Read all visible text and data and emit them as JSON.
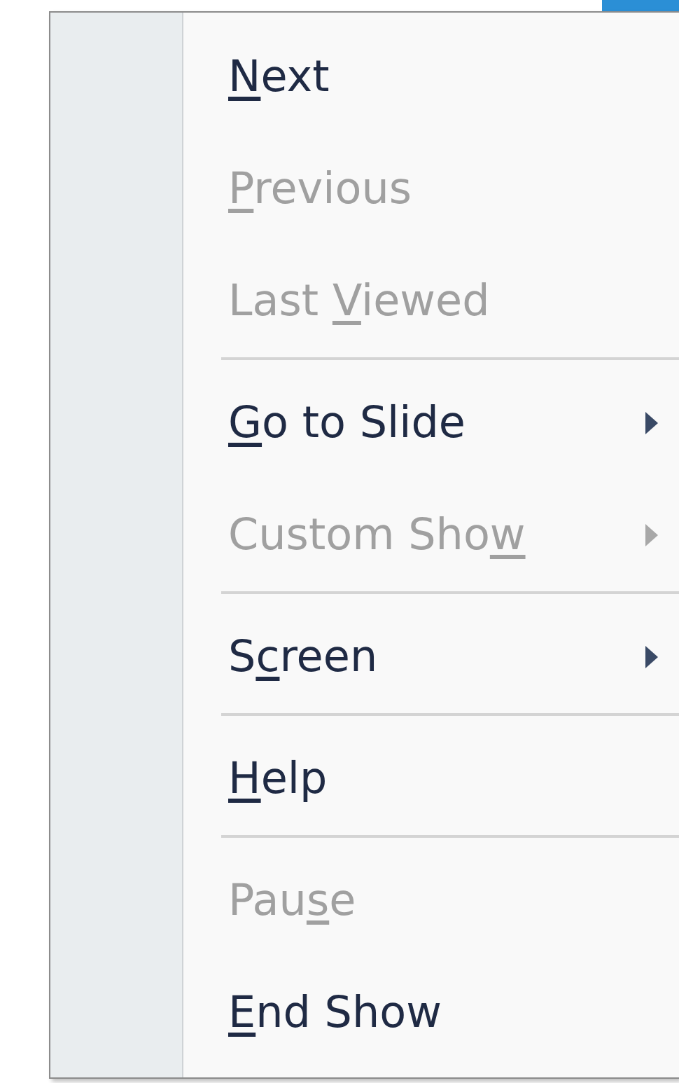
{
  "menu": {
    "items": [
      {
        "kind": "item",
        "key": "N",
        "after": "ext",
        "disabled": false,
        "submenu": false
      },
      {
        "kind": "item",
        "key": "P",
        "after": "revious",
        "disabled": true,
        "submenu": false
      },
      {
        "kind": "item",
        "before": "Last ",
        "key": "V",
        "after": "iewed",
        "disabled": true,
        "submenu": false
      },
      {
        "kind": "separator"
      },
      {
        "kind": "item",
        "key": "G",
        "after": "o to Slide",
        "disabled": false,
        "submenu": true
      },
      {
        "kind": "item",
        "before": "Custom Sho",
        "key": "w",
        "disabled": true,
        "submenu": true
      },
      {
        "kind": "separator"
      },
      {
        "kind": "item",
        "before": "S",
        "key": "c",
        "after": "reen",
        "disabled": false,
        "submenu": true
      },
      {
        "kind": "separator"
      },
      {
        "kind": "item",
        "key": "H",
        "after": "elp",
        "disabled": false,
        "submenu": false
      },
      {
        "kind": "separator"
      },
      {
        "kind": "item",
        "before": "Pau",
        "key": "s",
        "after": "e",
        "disabled": true,
        "submenu": false
      },
      {
        "kind": "item",
        "key": "E",
        "after": "nd Show",
        "disabled": false,
        "submenu": false
      }
    ]
  }
}
